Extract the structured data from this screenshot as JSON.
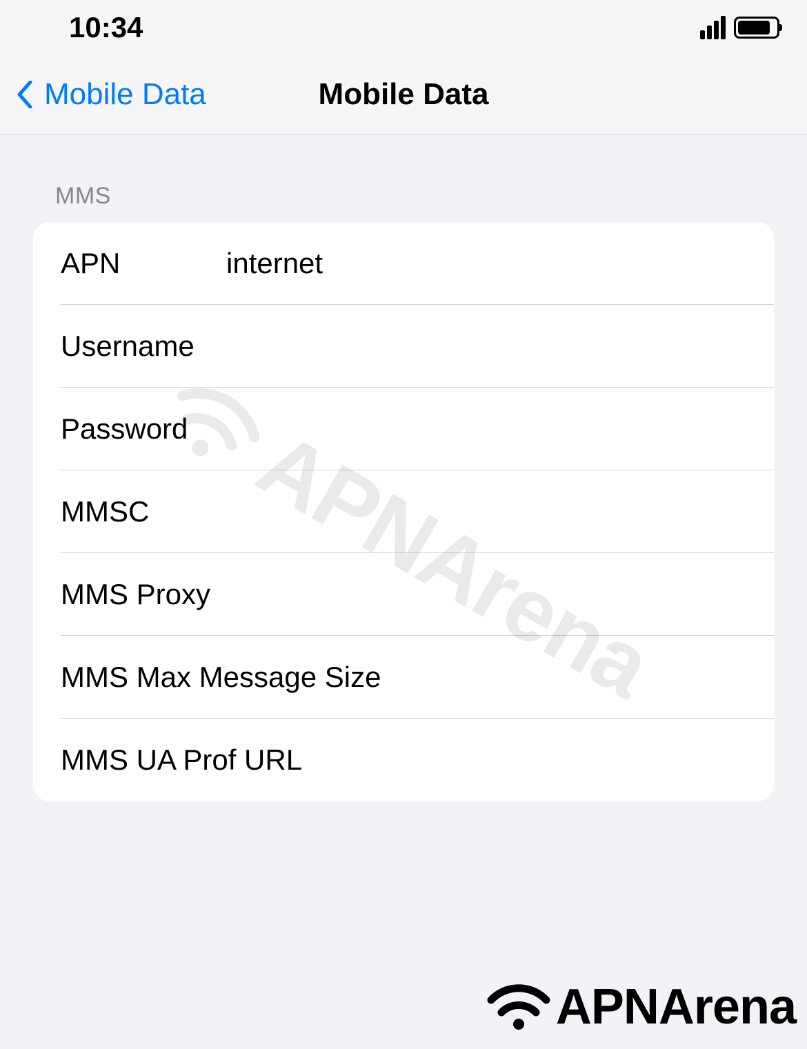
{
  "status": {
    "time": "10:34"
  },
  "nav": {
    "back_label": "Mobile Data",
    "title": "Mobile Data"
  },
  "section": {
    "header": "MMS"
  },
  "fields": {
    "apn": {
      "label": "APN",
      "value": "internet"
    },
    "username": {
      "label": "Username",
      "value": ""
    },
    "password": {
      "label": "Password",
      "value": ""
    },
    "mmsc": {
      "label": "MMSC",
      "value": ""
    },
    "mms_proxy": {
      "label": "MMS Proxy",
      "value": ""
    },
    "mms_max_size": {
      "label": "MMS Max Message Size",
      "value": ""
    },
    "mms_ua_prof": {
      "label": "MMS UA Prof URL",
      "value": ""
    }
  },
  "brand": {
    "name": "APNArena"
  }
}
